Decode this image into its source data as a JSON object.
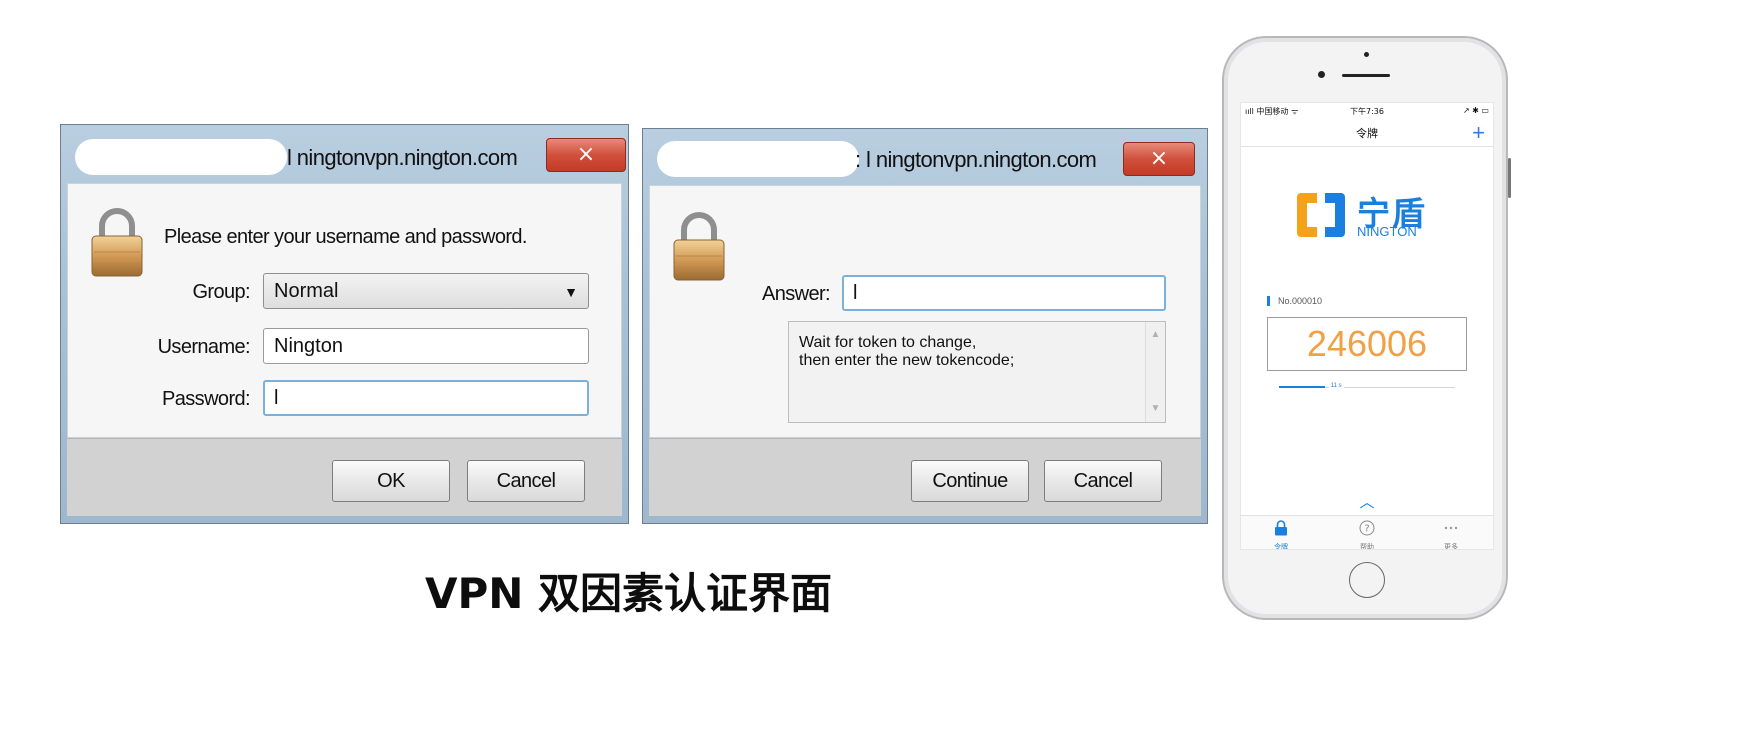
{
  "dialog1": {
    "title": "l ningtonvpn.nington.com",
    "close_glyph": "×",
    "prompt": "Please enter your username and password.",
    "group_label": "Group:",
    "group_value": "Normal",
    "username_label": "Username:",
    "username_value": "Nington",
    "password_label": "Password:",
    "password_value": "l",
    "ok_label": "OK",
    "cancel_label": "Cancel"
  },
  "dialog2": {
    "title": ": l ningtonvpn.nington.com",
    "close_glyph": "×",
    "answer_label": "Answer:",
    "answer_value": "l",
    "message_line1": "Wait for token to change,",
    "message_line2": "then enter the new tokencode;",
    "continue_label": "Continue",
    "cancel_label": "Cancel"
  },
  "caption": "VPN 双因素认证界面",
  "phone": {
    "status_left": "ııll 中国移动 ᯤ",
    "status_time": "下午7:36",
    "status_right": "↗ ✱ ▭",
    "nav_title": "令牌",
    "nav_plus": "+",
    "logo_cn": "宁盾",
    "logo_en": "NINGTON",
    "token_number": "No.000010",
    "token_code": "246006",
    "seconds_left": "11 s",
    "progress_fraction": 0.26,
    "chevron": "︿",
    "tabs": [
      {
        "label": "令牌",
        "icon": "lock-icon"
      },
      {
        "label": "帮助",
        "icon": "help-icon"
      },
      {
        "label": "更多",
        "icon": "more-icon"
      }
    ],
    "accent_color": "#1b7fe0",
    "token_color": "#f0a047"
  }
}
